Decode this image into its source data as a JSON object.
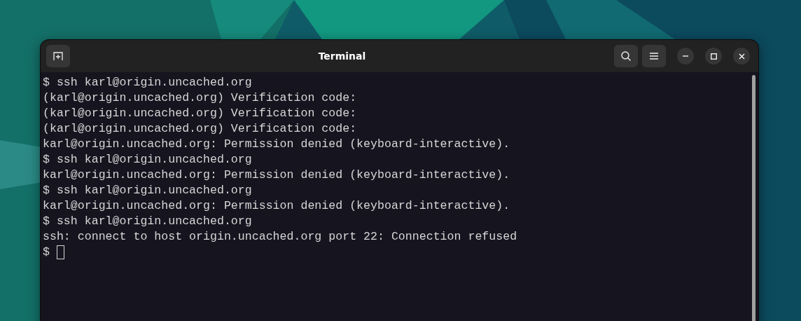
{
  "window": {
    "title": "Terminal"
  },
  "terminal": {
    "lines": [
      "$ ssh karl@origin.uncached.org",
      "(karl@origin.uncached.org) Verification code:",
      "(karl@origin.uncached.org) Verification code:",
      "(karl@origin.uncached.org) Verification code:",
      "karl@origin.uncached.org: Permission denied (keyboard-interactive).",
      "$ ssh karl@origin.uncached.org",
      "karl@origin.uncached.org: Permission denied (keyboard-interactive).",
      "$ ssh karl@origin.uncached.org",
      "karl@origin.uncached.org: Permission denied (keyboard-interactive).",
      "$ ssh karl@origin.uncached.org",
      "ssh: connect to host origin.uncached.org port 22: Connection refused"
    ],
    "prompt": "$"
  }
}
